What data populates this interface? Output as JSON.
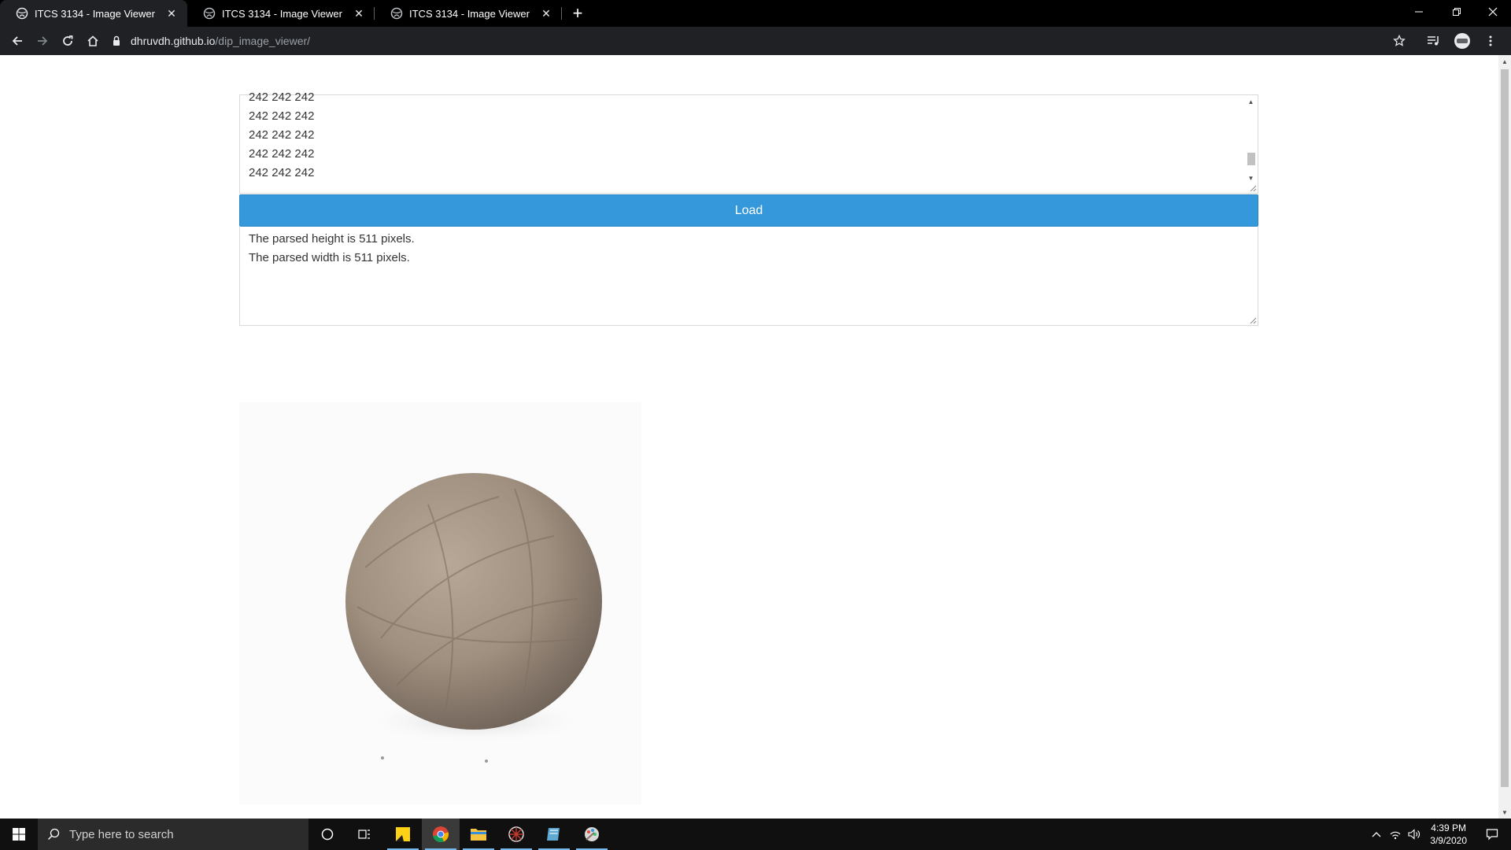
{
  "browser": {
    "tabs": [
      {
        "title": "ITCS 3134 - Image Viewer",
        "active": true
      },
      {
        "title": "ITCS 3134 - Image Viewer",
        "active": false
      },
      {
        "title": "ITCS 3134 - Image Viewer",
        "active": false
      }
    ],
    "url": {
      "host": "dhruvdh.github.io",
      "path": "/dip_image_viewer/"
    }
  },
  "input_area": {
    "lines": "242 242 242\n242 242 242\n242 242 242\n242 242 242\n242 242 242"
  },
  "load_button": {
    "label": "Load"
  },
  "output_area": {
    "line1": "The parsed height is 511 pixels.",
    "line2": "The parsed width is 511 pixels."
  },
  "taskbar": {
    "search_placeholder": "Type here to search",
    "time": "4:39 PM",
    "date": "3/9/2020"
  },
  "colors": {
    "load_button": "#3498db",
    "chrome_bg": "#202124"
  }
}
